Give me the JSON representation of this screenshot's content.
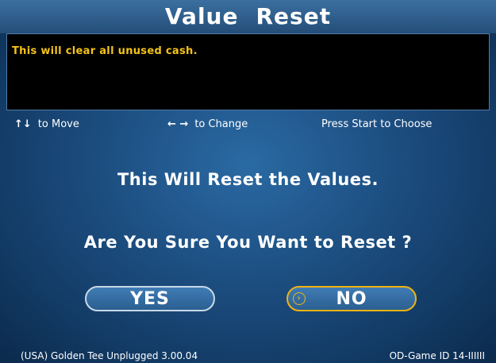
{
  "header": {
    "title_word1": "Value",
    "title_word2": "Reset"
  },
  "message": {
    "text": "This will clear all unused cash."
  },
  "controls": {
    "move": {
      "icon": "↑↓",
      "label": "to Move"
    },
    "change": {
      "icon": "← →",
      "label": "to Change"
    },
    "choose": {
      "label": "Press Start to Choose"
    }
  },
  "prompt": {
    "line1": "This Will Reset the Values.",
    "line2": "Are You Sure You Want to Reset ?"
  },
  "buttons": {
    "yes_label": "YES",
    "no_label": "NO",
    "selected": "NO",
    "selector_icon": "›"
  },
  "footer": {
    "version": "(USA) Golden Tee Unplugged 3.00.04",
    "game_id": "OD-Game ID 14-IIIIII"
  },
  "colors": {
    "accent": "#f0b313",
    "message_text": "#f3c21a",
    "background": "#1d4f82"
  }
}
